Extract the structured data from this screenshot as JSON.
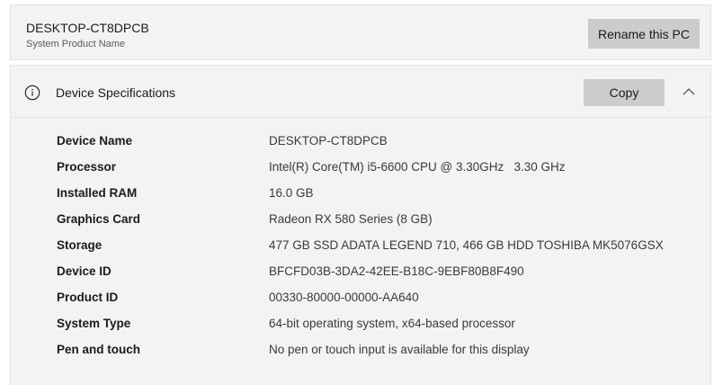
{
  "pc": {
    "name": "DESKTOP-CT8DPCB",
    "subtitle": "System Product Name",
    "rename_label": "Rename this PC"
  },
  "spec_section": {
    "info_icon": "info-circle-icon",
    "title": "Device Specifications",
    "copy_label": "Copy",
    "collapse_icon": "chevron-up-icon",
    "rows": [
      {
        "label": "Device Name",
        "value": "DESKTOP-CT8DPCB"
      },
      {
        "label": "Processor",
        "value": "Intel(R) Core(TM) i5-6600 CPU @ 3.30GHz   3.30 GHz"
      },
      {
        "label": "Installed RAM",
        "value": "16.0 GB"
      },
      {
        "label": "Graphics Card",
        "value": "Radeon RX 580 Series (8 GB)"
      },
      {
        "label": "Storage",
        "value": "477 GB SSD ADATA LEGEND 710, 466 GB HDD TOSHIBA MK5076GSX"
      },
      {
        "label": "Device ID",
        "value": "BFCFD03B-3DA2-42EE-B18C-9EBF80B8F490"
      },
      {
        "label": "Product ID",
        "value": "00330-80000-00000-AA640"
      },
      {
        "label": "System Type",
        "value": "64-bit operating system, x64-based processor"
      },
      {
        "label": "Pen and touch",
        "value": "No pen or touch input is available for this display"
      }
    ]
  },
  "colors": {
    "card_background": "#f3f3f3",
    "button_background": "#cccccc",
    "text_primary": "#1b1b1b"
  }
}
